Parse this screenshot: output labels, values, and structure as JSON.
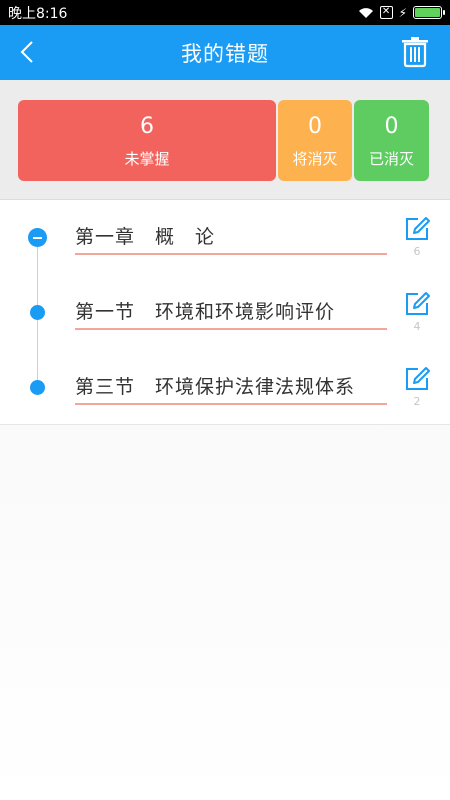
{
  "status_bar": {
    "time": "晚上8:16"
  },
  "header": {
    "title": "我的错题"
  },
  "stats": [
    {
      "value": "6",
      "label": "未掌握",
      "color": "#f3635d"
    },
    {
      "value": "0",
      "label": "将消灭",
      "color": "#fdb24f"
    },
    {
      "value": "0",
      "label": "已消灭",
      "color": "#5fcc62"
    }
  ],
  "items": [
    {
      "text": "第一章　概　论",
      "count": "6",
      "expanded": true
    },
    {
      "text": "第一节　环境和环境影响评价",
      "count": "4"
    },
    {
      "text": "第三节　环境保护法律法规体系",
      "count": "2"
    }
  ],
  "colors": {
    "accent": "#1b9cf4",
    "underline": "#f4a69a"
  },
  "icons": [
    "back-arrow-icon",
    "trash-icon",
    "edit-icon",
    "wifi-icon",
    "sim-icon",
    "battery-icon"
  ]
}
